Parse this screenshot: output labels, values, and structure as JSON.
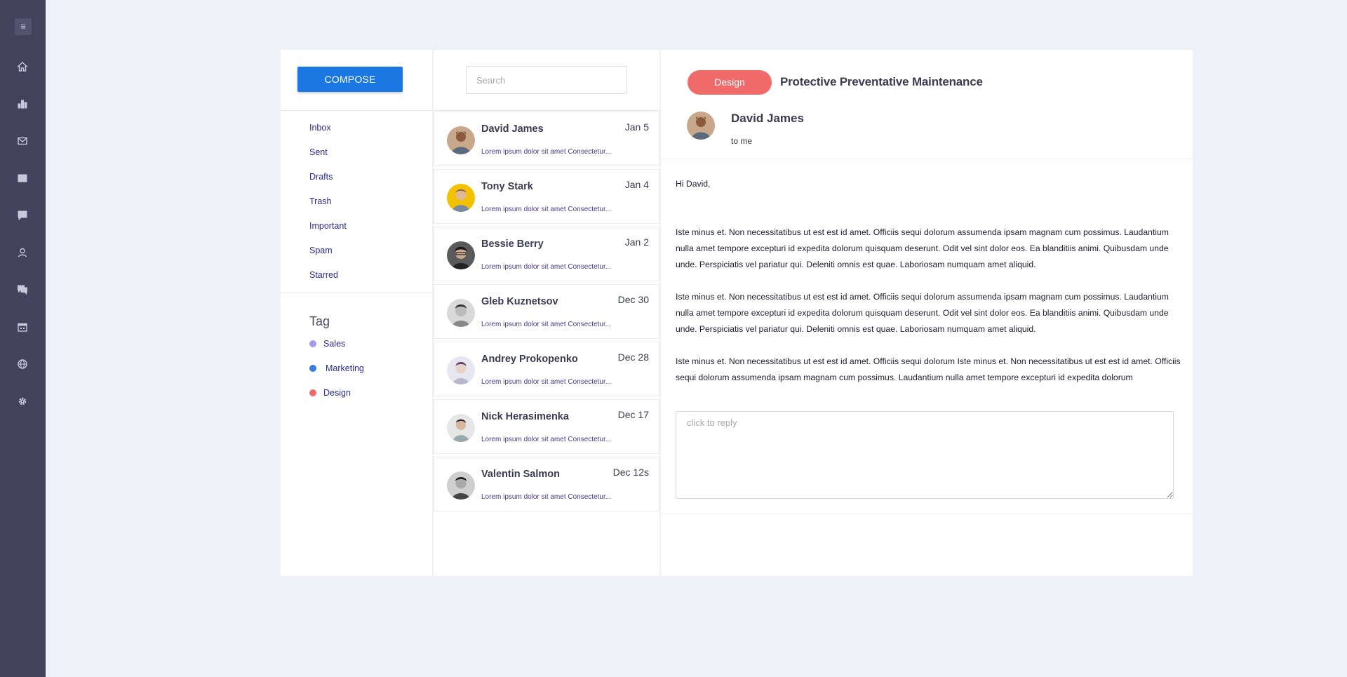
{
  "rail": {
    "menu_glyph": "≡",
    "icons": [
      "home-icon",
      "bar-chart-icon",
      "mail-icon",
      "barcode-icon",
      "message-icon",
      "user-icon",
      "chat-icon",
      "calendar-icon",
      "globe-icon",
      "gear-icon"
    ]
  },
  "compose": {
    "label": "COMPOSE"
  },
  "folders": [
    "Inbox",
    "Sent",
    "Drafts",
    "Trash",
    "Important",
    "Spam",
    "Starred"
  ],
  "tags": {
    "title": "Tag",
    "items": [
      {
        "label": "Sales",
        "color": "#a59bf0"
      },
      {
        "label": "Marketing",
        "color": "#3b7be6"
      },
      {
        "label": "Design",
        "color": "#f06a6a"
      }
    ]
  },
  "search": {
    "placeholder": "Search",
    "value": ""
  },
  "mails": [
    {
      "name": "David James",
      "date": "Jan 5",
      "snippet": "Lorem ipsum dolor sit amet Consectetur...",
      "avatar_bg": "#c9a78a"
    },
    {
      "name": "Tony Stark",
      "date": "Jan 4",
      "snippet": "Lorem ipsum dolor sit amet Consectetur...",
      "avatar_bg": "#f2c200"
    },
    {
      "name": "Bessie Berry",
      "date": "Jan 2",
      "snippet": "Lorem ipsum dolor sit amet Consectetur...",
      "avatar_bg": "#5a5a5a"
    },
    {
      "name": "Gleb Kuznetsov",
      "date": "Dec 30",
      "snippet": "Lorem ipsum dolor sit amet Consectetur...",
      "avatar_bg": "#d9d9d9"
    },
    {
      "name": "Andrey Prokopenko",
      "date": "Dec 28",
      "snippet": "Lorem ipsum dolor sit amet Consectetur...",
      "avatar_bg": "#e8e6f0"
    },
    {
      "name": "Nick Herasimenka",
      "date": "Dec 17",
      "snippet": "Lorem ipsum dolor sit amet Consectetur...",
      "avatar_bg": "#e6e6e6"
    },
    {
      "name": "Valentin Salmon",
      "date": "Dec 12s",
      "snippet": "Lorem ipsum dolor sit amet Consectetur...",
      "avatar_bg": "#cfcfcf"
    }
  ],
  "message": {
    "tag": "Design",
    "tag_color": "#f06a6a",
    "subject": "Protective Preventative Maintenance",
    "sender": "David James",
    "recipient": "to me",
    "greeting": "Hi David,",
    "paragraphs": [
      "Iste minus et. Non necessitatibus ut est est id amet. Officiis sequi dolorum assumenda ipsam magnam cum possimus. Laudantium nulla amet tempore excepturi id expedita dolorum quisquam deserunt. Odit vel sint dolor eos. Ea blanditiis animi. Quibusdam unde unde. Perspiciatis vel pariatur qui. Deleniti omnis est quae. Laboriosam numquam amet aliquid.",
      "Iste minus et. Non necessitatibus ut est est id amet. Officiis sequi dolorum assumenda ipsam magnam cum possimus. Laudantium nulla amet tempore excepturi id expedita dolorum quisquam deserunt. Odit vel sint dolor eos. Ea blanditiis animi. Quibusdam unde unde. Perspiciatis vel pariatur qui. Deleniti omnis est quae. Laboriosam numquam amet aliquid.",
      "Iste minus et. Non necessitatibus ut est est id amet. Officiis sequi dolorum Iste minus et. Non necessitatibus ut est est id amet. Officiis sequi dolorum assumenda ipsam magnam cum possimus. Laudantium nulla amet tempore excepturi id expedita dolorum"
    ],
    "reply_placeholder": "click to reply"
  }
}
